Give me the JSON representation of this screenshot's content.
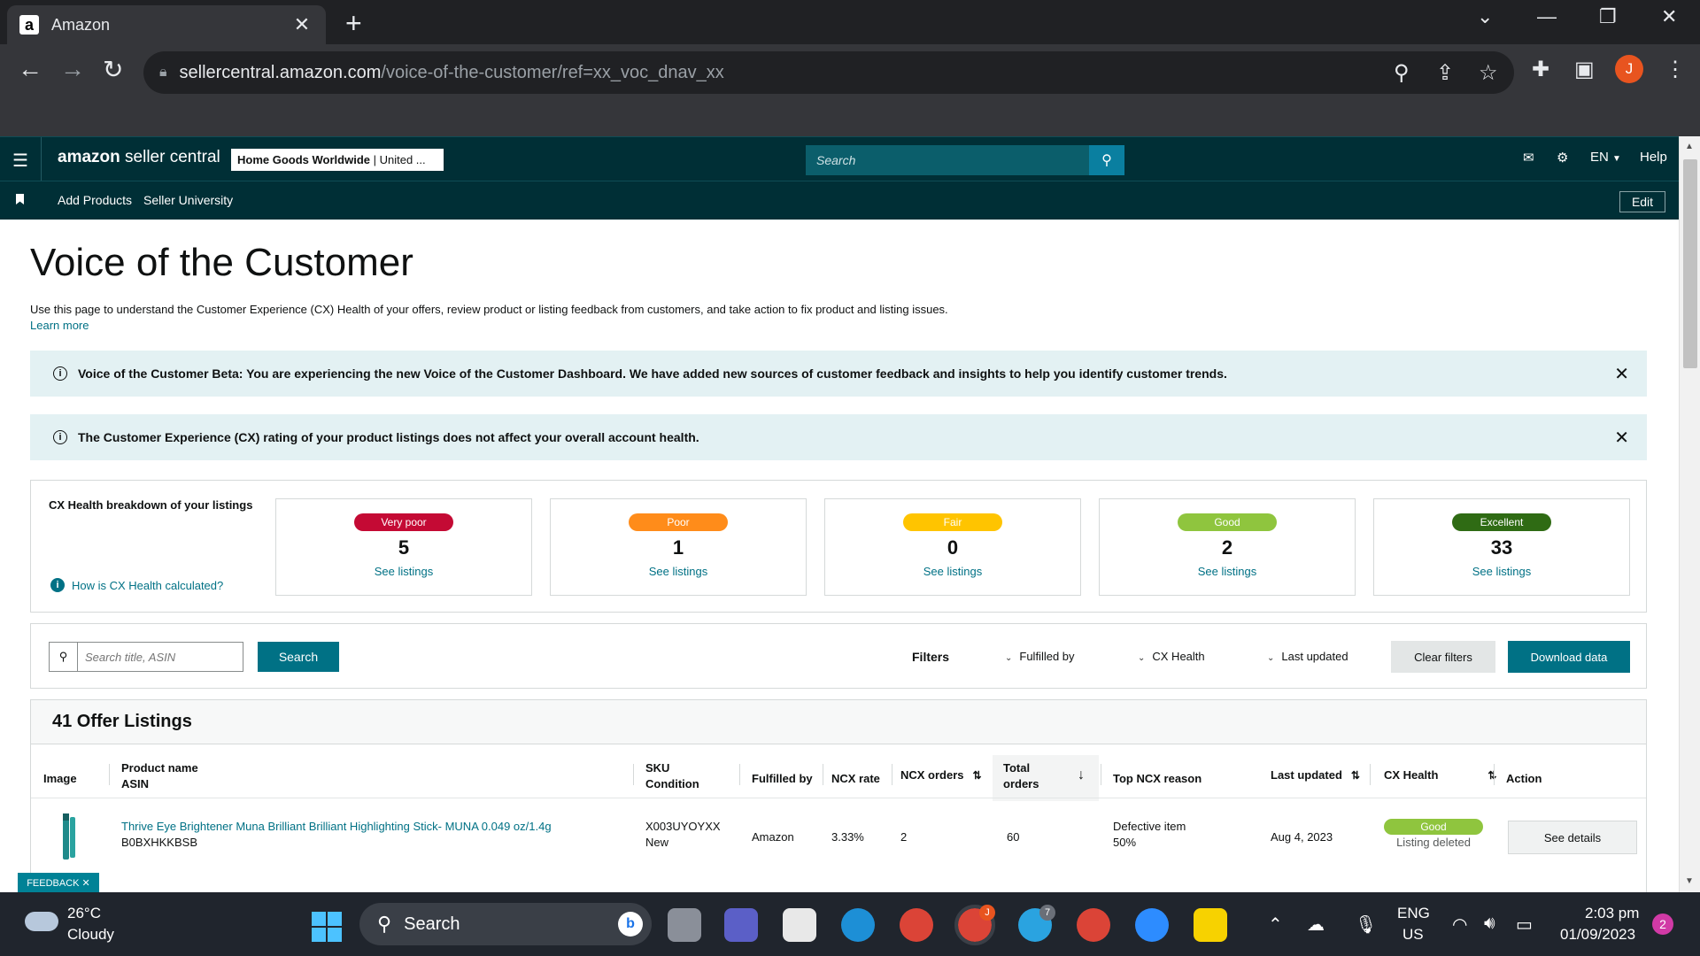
{
  "browser": {
    "tab_title": "Amazon",
    "tab_favicon": "a",
    "url_host": "sellercentral.amazon.com",
    "url_path": "/voice-of-the-customer/ref=xx_voc_dnav_xx",
    "profile_initial": "J"
  },
  "header": {
    "logo_brand": "amazon",
    "logo_suffix": " seller central",
    "store_name": "Home Goods Worldwide",
    "store_region": " | United ...",
    "search_placeholder": "Search",
    "language": "EN",
    "help": "Help"
  },
  "nav": {
    "items": [
      "Add Products",
      "Seller University"
    ],
    "edit": "Edit"
  },
  "page": {
    "title": "Voice of the Customer",
    "description": "Use this page to understand the Customer Experience (CX) Health of your offers, review product or listing feedback from customers, and take action to fix product and listing issues.",
    "learn_more": "Learn more"
  },
  "banners": [
    {
      "text": "Voice of the Customer Beta: You are experiencing the new Voice of the Customer Dashboard. We have added new sources of customer feedback and insights to help you identify customer trends."
    },
    {
      "text": "The Customer Experience (CX) rating of your product listings does not affect your overall account health."
    }
  ],
  "cx_health": {
    "label": "CX Health breakdown of your listings",
    "how_link": "How is CX Health calculated?",
    "see_listings": "See listings",
    "cards": [
      {
        "label": "Very poor",
        "count": "5",
        "color": "#c40a34"
      },
      {
        "label": "Poor",
        "count": "1",
        "color": "#ff8c1a"
      },
      {
        "label": "Fair",
        "count": "0",
        "color": "#ffc400"
      },
      {
        "label": "Good",
        "count": "2",
        "color": "#8fc53e"
      },
      {
        "label": "Excellent",
        "count": "33",
        "color": "#2f6b14"
      }
    ]
  },
  "filters": {
    "search_placeholder": "Search title, ASIN",
    "search_button": "Search",
    "filters_label": "Filters",
    "dropdowns": [
      "Fulfilled by",
      "CX Health",
      "Last updated"
    ],
    "clear": "Clear filters",
    "download": "Download data"
  },
  "listings": {
    "heading": "41 Offer Listings",
    "columns": {
      "image": "Image",
      "product_name": "Product name",
      "asin": "ASIN",
      "sku": "SKU",
      "condition": "Condition",
      "fulfilled_by": "Fulfilled by",
      "ncx_rate": "NCX rate",
      "ncx_orders": "NCX orders",
      "total_orders_1": "Total",
      "total_orders_2": "orders",
      "top_reason": "Top NCX reason",
      "last_updated": "Last updated",
      "cx_health": "CX Health",
      "action": "Action"
    },
    "rows": [
      {
        "product_name": "Thrive Eye Brightener Muna Brilliant Brilliant Highlighting Stick- MUNA 0.049 oz/1.4g",
        "asin": "B0BXHKKBSB",
        "sku": "X003UYOYXX",
        "condition": "New",
        "fulfilled_by": "Amazon",
        "ncx_rate": "3.33%",
        "ncx_orders": "2",
        "total_orders": "60",
        "top_reason": "Defective item",
        "top_reason_pct": "50%",
        "last_updated": "Aug 4, 2023",
        "cx_health": "Good",
        "cx_status": "Listing deleted",
        "action": "See details"
      }
    ]
  },
  "feedback": "FEEDBACK ✕",
  "taskbar": {
    "temperature": "26°C",
    "condition": "Cloudy",
    "search": "Search",
    "lang_1": "ENG",
    "lang_2": "US",
    "time": "2:03 pm",
    "date": "01/09/2023",
    "notification_count": "2",
    "badge_chrome": "J",
    "badge_telegram": "7"
  }
}
